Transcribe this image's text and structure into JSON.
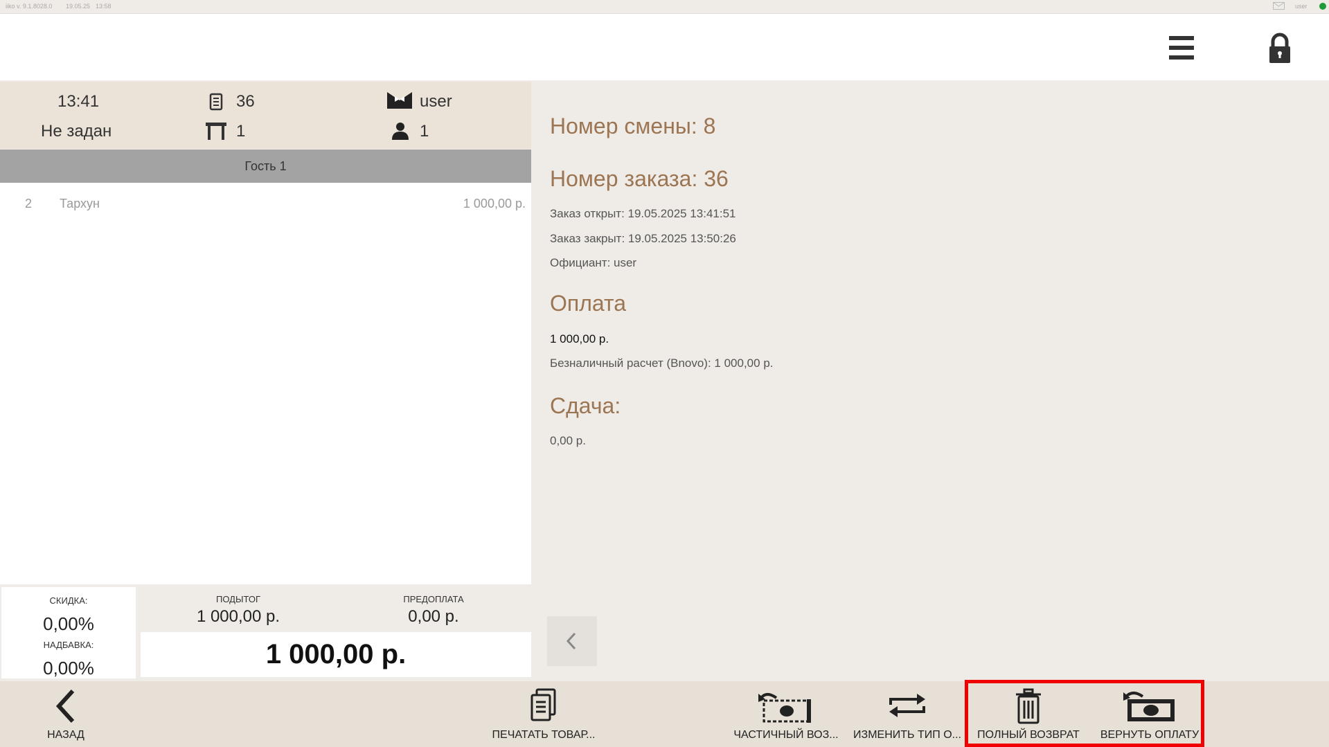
{
  "statusbar": {
    "version": "iiko v. 9.1.8028.0",
    "date": "19.05.25",
    "time": "13:58",
    "user": "user",
    "status_color": "#1f9b3a"
  },
  "header": {
    "menu_icon": "hamburger-icon",
    "lock_icon": "lock-icon"
  },
  "order_info": {
    "time": "13:41",
    "order_number": "36",
    "waiter": "user",
    "table_status": "Не задан",
    "table_count": "1",
    "guests_count": "1"
  },
  "guest": {
    "label": "Гость 1",
    "items": [
      {
        "qty": "2",
        "name": "Тархун",
        "price": "1 000,00 р."
      }
    ]
  },
  "totals": {
    "discount_label": "СКИДКА:",
    "discount_value": "0,00%",
    "surcharge_label": "НАДБАВКА:",
    "surcharge_value": "0,00%",
    "subtotal_label": "ПОДЫТОГ",
    "subtotal_value": "1 000,00 р.",
    "prepay_label": "ПРЕДОПЛАТА",
    "prepay_value": "0,00 р.",
    "total_value": "1 000,00 р."
  },
  "details": {
    "shift": "Номер смены: 8",
    "order": "Номер заказа: 36",
    "opened": "Заказ открыт: 19.05.2025 13:41:51",
    "closed": "Заказ закрыт: 19.05.2025 13:50:26",
    "waiter": "Официант: user",
    "payment_title": "Оплата",
    "payment_amount": "1 000,00 р.",
    "payment_method": "Безналичный расчет (Bnovo): 1 000,00 р.",
    "change_title": "Сдача:",
    "change_value": "0,00 р."
  },
  "toolbar": {
    "back": "НАЗАД",
    "print": "ПЕЧАТАТЬ ТОВАР...",
    "partial_refund": "ЧАСТИЧНЫЙ ВОЗ...",
    "change_payment": "ИЗМЕНИТЬ ТИП О...",
    "full_refund": "ПОЛНЫЙ ВОЗВРАТ",
    "return_payment": "ВЕРНУТЬ ОПЛАТУ",
    "highlight_color": "#f00000"
  }
}
